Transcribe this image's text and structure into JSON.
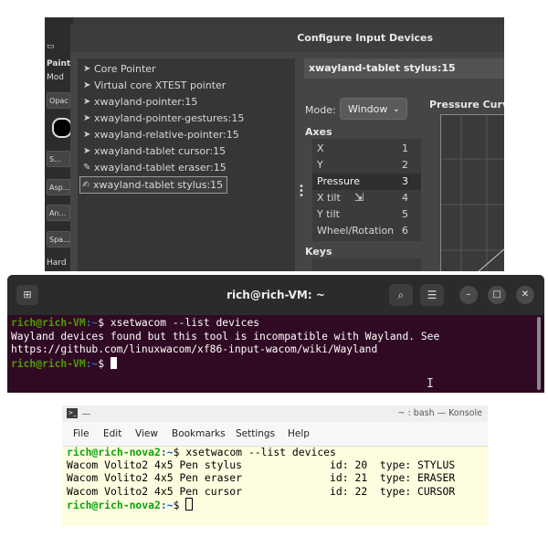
{
  "gimp": {
    "left_labels": [
      "Paint",
      "Mod",
      "Opac",
      "S...",
      "Asp...",
      "An...",
      "Spa...",
      "Hard"
    ],
    "dialog_title": "Configure Input Devices",
    "devices": [
      {
        "name": "Core Pointer",
        "icon": "pointer-arrow-icon"
      },
      {
        "name": "Virtual core XTEST pointer",
        "icon": "pointer-arrow-icon"
      },
      {
        "name": "xwayland-pointer:15",
        "icon": "pointer-arrow-icon"
      },
      {
        "name": "xwayland-pointer-gestures:15",
        "icon": "pointer-arrow-icon"
      },
      {
        "name": "xwayland-relative-pointer:15",
        "icon": "pointer-arrow-icon"
      },
      {
        "name": "xwayland-tablet cursor:15",
        "icon": "pointer-arrow-icon"
      },
      {
        "name": "xwayland-tablet eraser:15",
        "icon": "eraser-icon"
      },
      {
        "name": "xwayland-tablet stylus:15",
        "icon": "stylus-icon",
        "selected": true
      }
    ],
    "selected_device_header": "xwayland-tablet stylus:15",
    "mode_label": "Mode:",
    "mode_value": "Window",
    "axes_label": "Axes",
    "axes": [
      {
        "name": "X",
        "num": "1"
      },
      {
        "name": "Y",
        "num": "2"
      },
      {
        "name": "Pressure",
        "num": "3",
        "highlight": true
      },
      {
        "name": "X tilt",
        "num": "4"
      },
      {
        "name": "Y tilt",
        "num": "5"
      },
      {
        "name": "Wheel/Rotation",
        "num": "6"
      }
    ],
    "keys_label": "Keys",
    "pressure_curve_label": "Pressure Curve"
  },
  "ubuntu_terminal": {
    "title": "rich@rich-VM: ~",
    "prompt_user": "rich@rich-VM",
    "prompt_path": ":~",
    "prompt_symbol": "$ ",
    "command": "xsetwacom --list devices",
    "output_line1": "Wayland devices found but this tool is incompatible with Wayland. See",
    "output_line2": "https://github.com/linuxwacom/xf86-input-wacom/wiki/Wayland"
  },
  "konsole": {
    "title": "~ : bash — Konsole",
    "menu": [
      "File",
      "Edit",
      "View",
      "Bookmarks",
      "Settings",
      "Help"
    ],
    "prompt_user": "rich@rich-nova2",
    "prompt_path": ":~",
    "prompt_symbol": "$ ",
    "command": "xsetwacom --list devices",
    "rows": [
      "Wacom Volito2 4x5 Pen stylus              id: 20  type: STYLUS",
      "Wacom Volito2 4x5 Pen eraser              id: 21  type: ERASER",
      "Wacom Volito2 4x5 Pen cursor              id: 22  type: CURSOR"
    ]
  }
}
